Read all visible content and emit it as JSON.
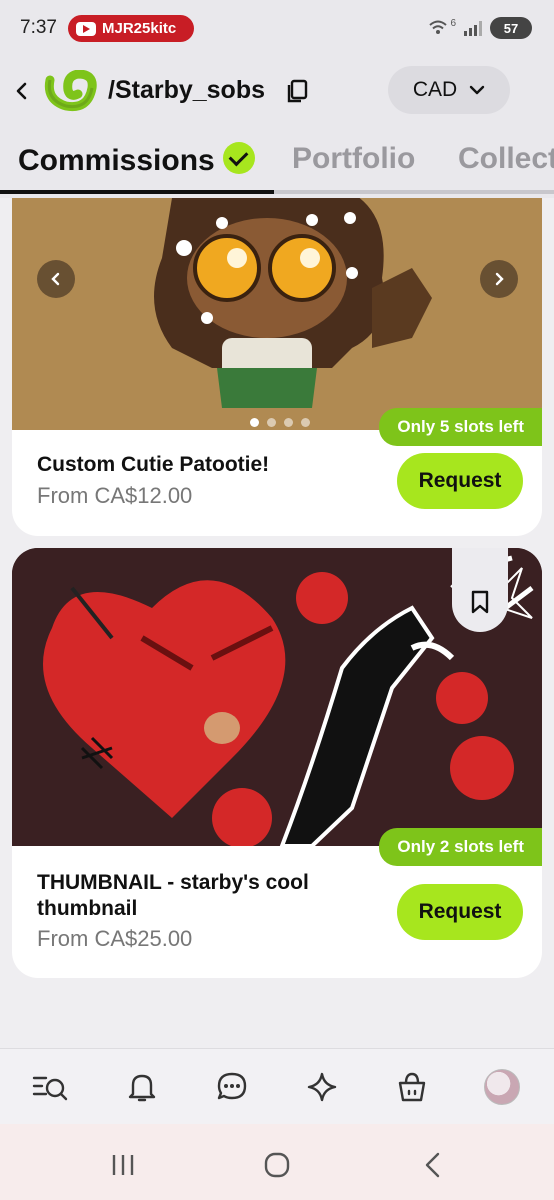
{
  "status_bar": {
    "time": "7:37",
    "notification_pill": "MJR25kitc",
    "network": "6",
    "battery": "57"
  },
  "header": {
    "username": "/Starby_sobs",
    "currency": "CAD",
    "accent_color": "#a7e61e"
  },
  "tabs": [
    {
      "label": "Commissions",
      "active": true
    },
    {
      "label": "Portfolio",
      "active": false
    },
    {
      "label": "Collect",
      "active": false
    }
  ],
  "commissions": [
    {
      "title": "Custom Cutie Patootie!",
      "price": "From CA$12.00",
      "slots": "Only 5 slots left",
      "button": "Request",
      "image_count": 4,
      "active_image": 1
    },
    {
      "title": "THUMBNAIL - starby's cool thumbnail",
      "price": "From CA$25.00",
      "slots": "Only 2 slots left",
      "button": "Request"
    }
  ],
  "bottom_nav": [
    "explore-icon",
    "bell-icon",
    "chat-icon",
    "sparkle-icon",
    "bag-icon",
    "avatar"
  ],
  "system_nav": [
    "recents-icon",
    "home-icon",
    "back-icon"
  ]
}
